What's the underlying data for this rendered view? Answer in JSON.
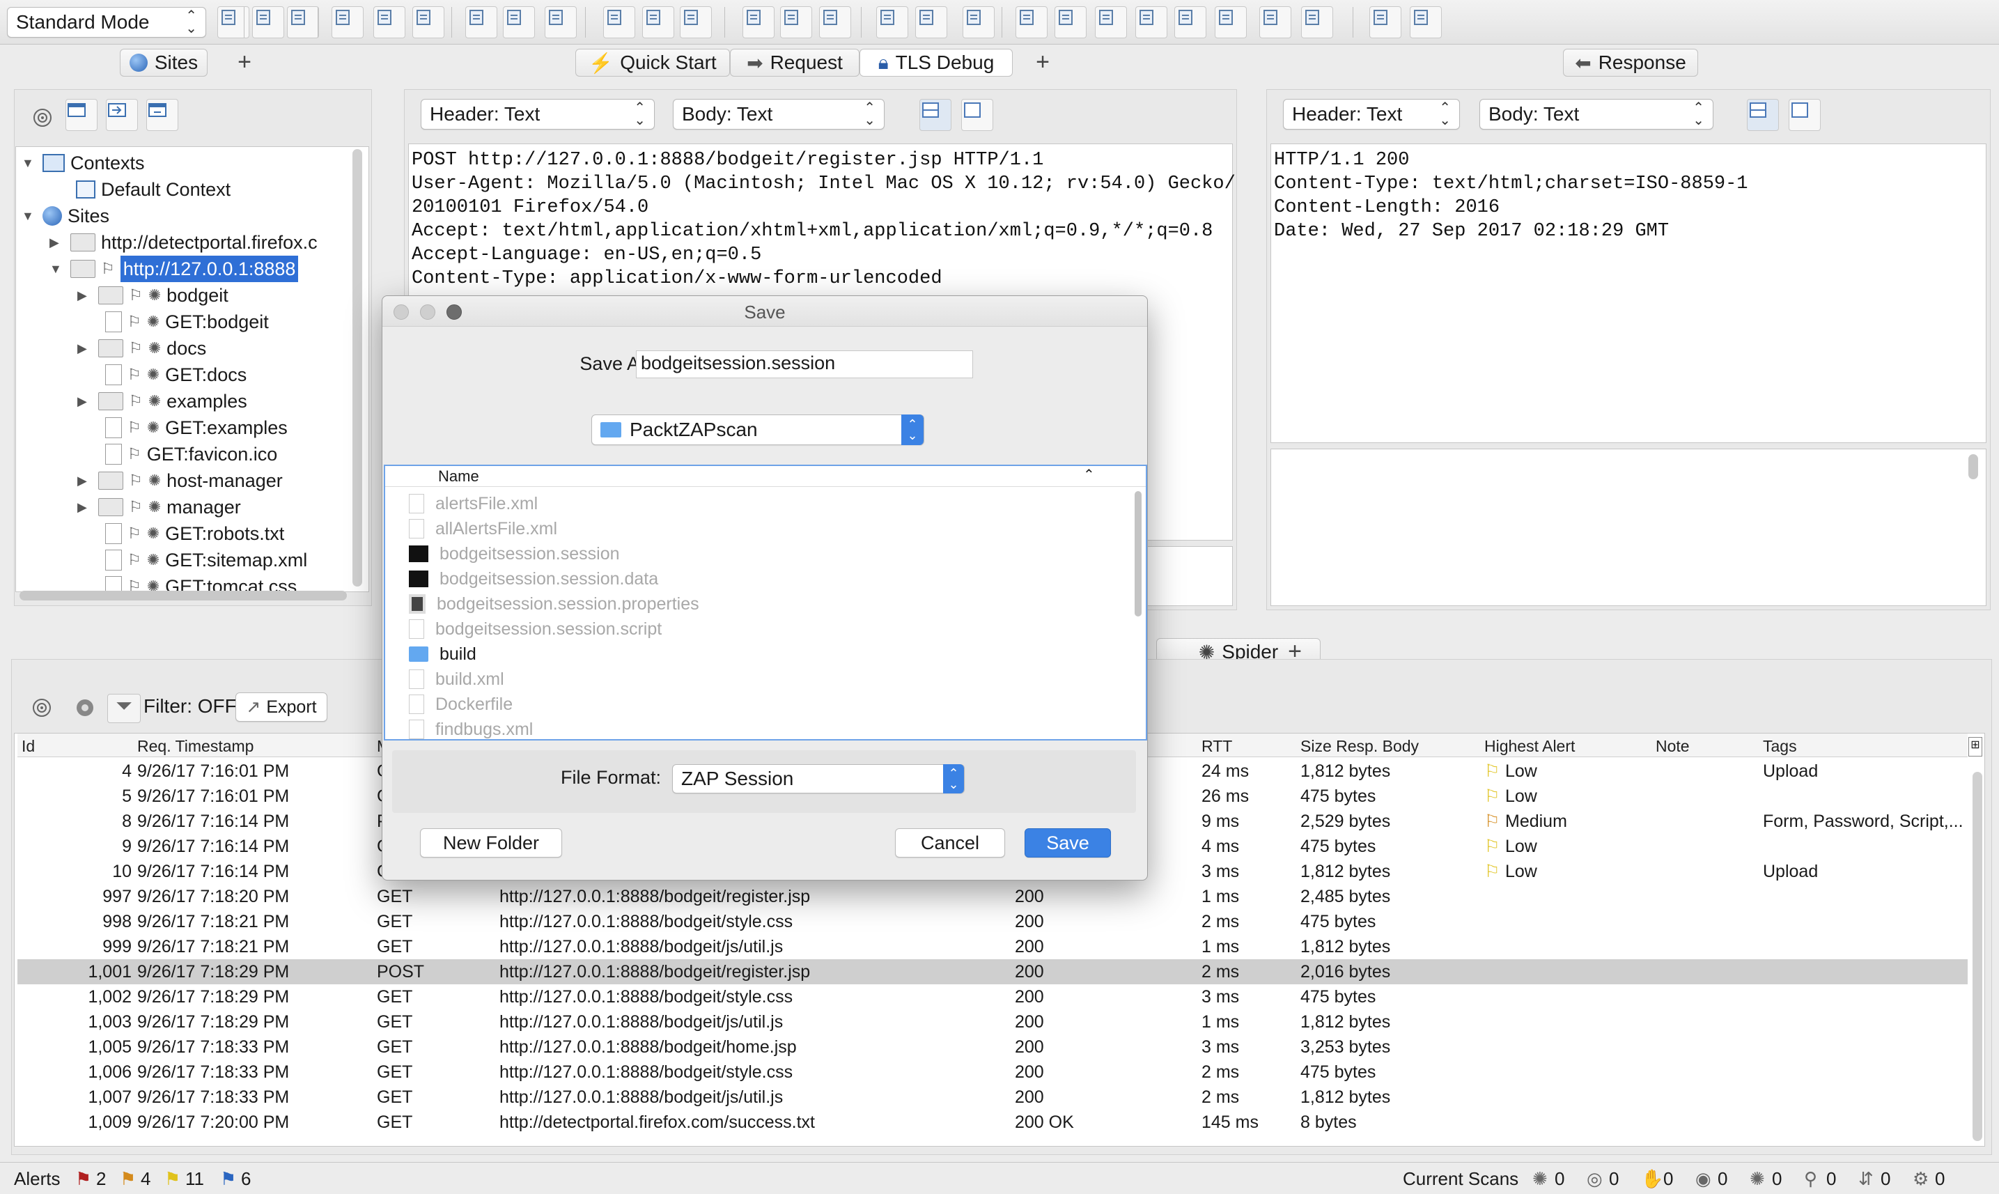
{
  "toolbar": {
    "mode": "Standard Mode"
  },
  "tabs": {
    "sites": "Sites",
    "quick_start": "Quick Start",
    "request": "Request",
    "tls_debug": "TLS Debug",
    "response": "Response",
    "spider": "Spider"
  },
  "request": {
    "header_select": "Header: Text",
    "body_select": "Body: Text",
    "lines": [
      "POST http://127.0.0.1:8888/bodgeit/register.jsp HTTP/1.1",
      "User-Agent: Mozilla/5.0 (Macintosh; Intel Mac OS X 10.12; rv:54.0) Gecko/",
      "20100101 Firefox/54.0",
      "Accept: text/html,application/xhtml+xml,application/xml;q=0.9,*/*;q=0.8",
      "Accept-Language: en-US,en;q=0.5",
      "Content-Type: application/x-www-form-urlencoded"
    ]
  },
  "response": {
    "header_select": "Header: Text",
    "body_select": "Body: Text",
    "lines": [
      "HTTP/1.1 200",
      "Content-Type: text/html;charset=ISO-8859-1",
      "Content-Length: 2016",
      "Date: Wed, 27 Sep 2017 02:18:29 GMT"
    ]
  },
  "tree": {
    "contexts": "Contexts",
    "default_context": "Default Context",
    "sites": "Sites",
    "site1": "http://detectportal.firefox.c",
    "site2": "http://127.0.0.1:8888",
    "children": [
      "bodgeit",
      "GET:bodgeit",
      "docs",
      "GET:docs",
      "examples",
      "GET:examples",
      "GET:favicon.ico",
      "host-manager",
      "manager",
      "GET:robots.txt",
      "GET:sitemap.xml",
      "GET:tomcat.css"
    ]
  },
  "history": {
    "filter_label": "Filter: OFF",
    "export_label": "Export",
    "columns": {
      "id": "Id",
      "timestamp": "Req. Timestamp",
      "method": "M",
      "rtt": "RTT",
      "size": "Size Resp. Body",
      "alert": "Highest Alert",
      "note": "Note",
      "tags": "Tags"
    },
    "rows": [
      {
        "id": "4",
        "ts": "9/26/17 7:16:01 PM",
        "method": "G",
        "url": "",
        "code": "",
        "rtt": "24 ms",
        "size": "1,812 bytes",
        "alert": "Low",
        "tags": "Upload"
      },
      {
        "id": "5",
        "ts": "9/26/17 7:16:01 PM",
        "method": "G",
        "url": "",
        "code": "",
        "rtt": "26 ms",
        "size": "475 bytes",
        "alert": "Low",
        "tags": ""
      },
      {
        "id": "8",
        "ts": "9/26/17 7:16:14 PM",
        "method": "P",
        "url": "",
        "code": "",
        "rtt": "9 ms",
        "size": "2,529 bytes",
        "alert": "Medium",
        "tags": "Form, Password, Script,..."
      },
      {
        "id": "9",
        "ts": "9/26/17 7:16:14 PM",
        "method": "G",
        "url": "",
        "code": "",
        "rtt": "4 ms",
        "size": "475 bytes",
        "alert": "Low",
        "tags": ""
      },
      {
        "id": "10",
        "ts": "9/26/17 7:16:14 PM",
        "method": "GE",
        "url": "",
        "code": "",
        "rtt": "3 ms",
        "size": "1,812 bytes",
        "alert": "Low",
        "tags": "Upload"
      },
      {
        "id": "997",
        "ts": "9/26/17 7:18:20 PM",
        "method": "GET",
        "url": "http://127.0.0.1:8888/bodgeit/register.jsp",
        "code": "200",
        "rtt": "1 ms",
        "size": "2,485 bytes",
        "alert": "",
        "tags": ""
      },
      {
        "id": "998",
        "ts": "9/26/17 7:18:21 PM",
        "method": "GET",
        "url": "http://127.0.0.1:8888/bodgeit/style.css",
        "code": "200",
        "rtt": "2 ms",
        "size": "475 bytes",
        "alert": "",
        "tags": ""
      },
      {
        "id": "999",
        "ts": "9/26/17 7:18:21 PM",
        "method": "GET",
        "url": "http://127.0.0.1:8888/bodgeit/js/util.js",
        "code": "200",
        "rtt": "1 ms",
        "size": "1,812 bytes",
        "alert": "",
        "tags": ""
      },
      {
        "id": "1,001",
        "ts": "9/26/17 7:18:29 PM",
        "method": "POST",
        "url": "http://127.0.0.1:8888/bodgeit/register.jsp",
        "code": "200",
        "rtt": "2 ms",
        "size": "2,016 bytes",
        "alert": "",
        "tags": ""
      },
      {
        "id": "1,002",
        "ts": "9/26/17 7:18:29 PM",
        "method": "GET",
        "url": "http://127.0.0.1:8888/bodgeit/style.css",
        "code": "200",
        "rtt": "3 ms",
        "size": "475 bytes",
        "alert": "",
        "tags": ""
      },
      {
        "id": "1,003",
        "ts": "9/26/17 7:18:29 PM",
        "method": "GET",
        "url": "http://127.0.0.1:8888/bodgeit/js/util.js",
        "code": "200",
        "rtt": "1 ms",
        "size": "1,812 bytes",
        "alert": "",
        "tags": ""
      },
      {
        "id": "1,005",
        "ts": "9/26/17 7:18:33 PM",
        "method": "GET",
        "url": "http://127.0.0.1:8888/bodgeit/home.jsp",
        "code": "200",
        "rtt": "3 ms",
        "size": "3,253 bytes",
        "alert": "",
        "tags": ""
      },
      {
        "id": "1,006",
        "ts": "9/26/17 7:18:33 PM",
        "method": "GET",
        "url": "http://127.0.0.1:8888/bodgeit/style.css",
        "code": "200",
        "rtt": "2 ms",
        "size": "475 bytes",
        "alert": "",
        "tags": ""
      },
      {
        "id": "1,007",
        "ts": "9/26/17 7:18:33 PM",
        "method": "GET",
        "url": "http://127.0.0.1:8888/bodgeit/js/util.js",
        "code": "200",
        "rtt": "2 ms",
        "size": "1,812 bytes",
        "alert": "",
        "tags": ""
      },
      {
        "id": "1,009",
        "ts": "9/26/17 7:20:00 PM",
        "method": "GET",
        "url": "http://detectportal.firefox.com/success.txt",
        "code": "200 OK",
        "rtt": "145 ms",
        "size": "8 bytes",
        "alert": "",
        "tags": ""
      }
    ]
  },
  "dialog": {
    "title": "Save",
    "save_as_label": "Save As:",
    "filename": "bodgeitsession.session",
    "folder": "PacktZAPscan",
    "name_column": "Name",
    "files": [
      {
        "name": "alertsFile.xml",
        "kind": "doc"
      },
      {
        "name": "allAlertsFile.xml",
        "kind": "doc"
      },
      {
        "name": "bodgeitsession.session",
        "kind": "black"
      },
      {
        "name": "bodgeitsession.session.data",
        "kind": "black"
      },
      {
        "name": "bodgeitsession.session.properties",
        "kind": "props"
      },
      {
        "name": "bodgeitsession.session.script",
        "kind": "doc"
      },
      {
        "name": "build",
        "kind": "folder"
      },
      {
        "name": "build.xml",
        "kind": "doc"
      },
      {
        "name": "Dockerfile",
        "kind": "doc"
      },
      {
        "name": "findbugs.xml",
        "kind": "doc"
      }
    ],
    "format_label": "File Format:",
    "format_value": "ZAP Session",
    "new_folder": "New Folder",
    "cancel": "Cancel",
    "save": "Save"
  },
  "status": {
    "alerts_label": "Alerts",
    "alert_counts": [
      "2",
      "4",
      "11",
      "6"
    ],
    "current_scans": "Current Scans",
    "scan_counts": [
      "0",
      "0",
      "0",
      "0",
      "0",
      "0",
      "0",
      "0"
    ]
  },
  "colors": {
    "accent": "#3b82e4",
    "selection": "#cfcfcf",
    "link_select": "#2f6fd6"
  }
}
